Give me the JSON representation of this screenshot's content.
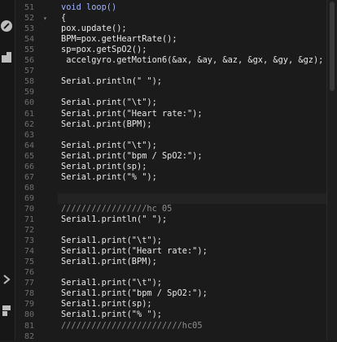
{
  "sidebar": {
    "icons": [
      "pencil-icon",
      "file-icon",
      "chevron-right-icon",
      "bookmark-icon"
    ]
  },
  "editor": {
    "current_line": "69",
    "lines": [
      {
        "n": "51",
        "fold": "",
        "code": "void loop()"
      },
      {
        "n": "52",
        "fold": "▾",
        "code": "{"
      },
      {
        "n": "53",
        "fold": "",
        "code": "pox.update();"
      },
      {
        "n": "54",
        "fold": "",
        "code": "BPM=pox.getHeartRate();"
      },
      {
        "n": "55",
        "fold": "",
        "code": "sp=pox.getSpO2();"
      },
      {
        "n": "56",
        "fold": "",
        "code": " accelgyro.getMotion6(&ax, &ay, &az, &gx, &gy, &gz);"
      },
      {
        "n": "57",
        "fold": "",
        "code": ""
      },
      {
        "n": "58",
        "fold": "",
        "code": "Serial.println(\" \");"
      },
      {
        "n": "59",
        "fold": "",
        "code": ""
      },
      {
        "n": "60",
        "fold": "",
        "code": "Serial.print(\"\\t\");"
      },
      {
        "n": "61",
        "fold": "",
        "code": "Serial.print(\"Heart rate:\");"
      },
      {
        "n": "62",
        "fold": "",
        "code": "Serial.print(BPM);"
      },
      {
        "n": "63",
        "fold": "",
        "code": ""
      },
      {
        "n": "64",
        "fold": "",
        "code": "Serial.print(\"\\t\");"
      },
      {
        "n": "65",
        "fold": "",
        "code": "Serial.print(\"bpm / SpO2:\");"
      },
      {
        "n": "66",
        "fold": "",
        "code": "Serial.print(sp);"
      },
      {
        "n": "67",
        "fold": "",
        "code": "Serial.print(\"% \");"
      },
      {
        "n": "68",
        "fold": "",
        "code": ""
      },
      {
        "n": "69",
        "fold": "",
        "code": ""
      },
      {
        "n": "70",
        "fold": "",
        "code": "/////////////////hc 05"
      },
      {
        "n": "71",
        "fold": "",
        "code": "Serial1.println(\" \");"
      },
      {
        "n": "72",
        "fold": "",
        "code": ""
      },
      {
        "n": "73",
        "fold": "",
        "code": "Serial1.print(\"\\t\");"
      },
      {
        "n": "74",
        "fold": "",
        "code": "Serial1.print(\"Heart rate:\");"
      },
      {
        "n": "75",
        "fold": "",
        "code": "Serial1.print(BPM);"
      },
      {
        "n": "76",
        "fold": "",
        "code": ""
      },
      {
        "n": "77",
        "fold": "",
        "code": "Serial1.print(\"\\t\");"
      },
      {
        "n": "78",
        "fold": "",
        "code": "Serial1.print(\"bpm / SpO2:\");"
      },
      {
        "n": "79",
        "fold": "",
        "code": "Serial1.print(sp);"
      },
      {
        "n": "80",
        "fold": "",
        "code": "Serial1.print(\"% \");"
      },
      {
        "n": "81",
        "fold": "",
        "code": "////////////////////////hc05"
      },
      {
        "n": "82",
        "fold": "",
        "code": ""
      }
    ]
  },
  "colors": {
    "background": "#1b1b1b",
    "text": "#e8e8e8",
    "line_number": "#6f6f6f",
    "keyword": "#9fb3ff"
  }
}
